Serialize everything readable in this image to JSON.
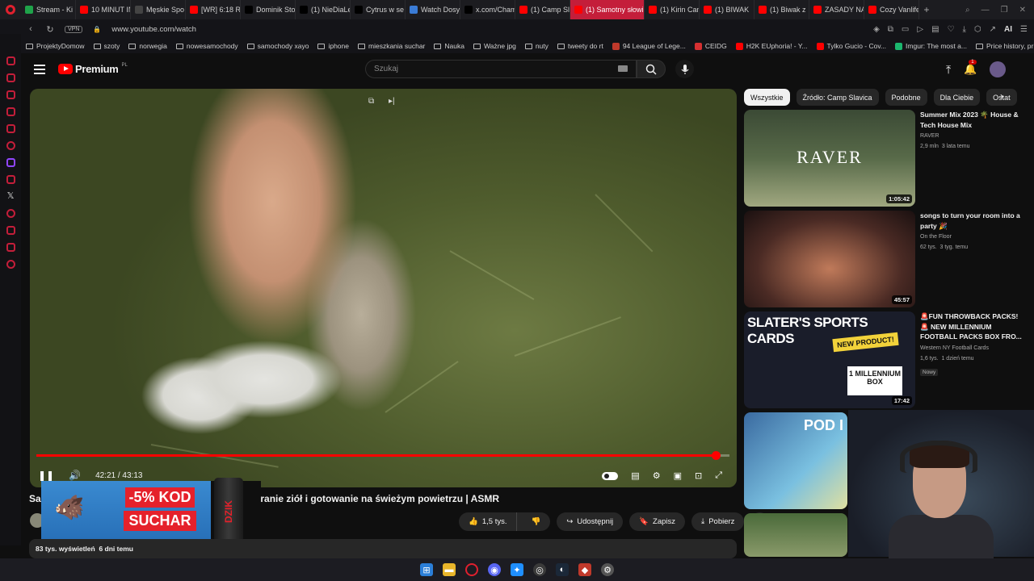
{
  "browser": {
    "tabs": [
      {
        "label": "Stream - Ki",
        "color": "#1fa34a"
      },
      {
        "label": "10 MINUT IN",
        "color": "#ff0000"
      },
      {
        "label": "Męskie Spo",
        "color": "#444444"
      },
      {
        "label": "[WR] 6:18 R",
        "color": "#ff0000"
      },
      {
        "label": "Dominik Sto",
        "color": "#000000"
      },
      {
        "label": "(1) NieDiaLe",
        "color": "#000000"
      },
      {
        "label": "Cytrus w se",
        "color": "#000000"
      },
      {
        "label": "Watch Dosy",
        "color": "#3a7bd5"
      },
      {
        "label": "x.com/Cham",
        "color": "#000000"
      },
      {
        "label": "(1) Camp Sla",
        "color": "#ff0000"
      },
      {
        "label": "(1) Samotny słowi",
        "color": "#ff0000",
        "active": true
      },
      {
        "label": "(1) Kirin Cam",
        "color": "#ff0000"
      },
      {
        "label": "(1) BIWAK",
        "color": "#ff0000"
      },
      {
        "label": "(1) Biwak z",
        "color": "#ff0000"
      },
      {
        "label": "ZASADY NA",
        "color": "#ff0000"
      },
      {
        "label": "Cozy Vanlife",
        "color": "#ff0000"
      }
    ],
    "url": "www.youtube.com/watch",
    "vpn_label": "VPN",
    "ai_label": "AI",
    "bookmarks": [
      {
        "label": "ProjektyDomow",
        "type": "folder"
      },
      {
        "label": "szoty",
        "type": "folder"
      },
      {
        "label": "norwegia",
        "type": "folder"
      },
      {
        "label": "nowesamochody",
        "type": "folder"
      },
      {
        "label": "samochody xayo",
        "type": "folder"
      },
      {
        "label": "iphone",
        "type": "folder"
      },
      {
        "label": "mieszkania suchar",
        "type": "folder"
      },
      {
        "label": "Nauka",
        "type": "folder"
      },
      {
        "label": "Ważne jpg",
        "type": "folder"
      },
      {
        "label": "nuty",
        "type": "folder"
      },
      {
        "label": "tweety do rt",
        "type": "folder"
      },
      {
        "label": "94 League of Lege...",
        "type": "site",
        "color": "#c0392b"
      },
      {
        "label": "CEIDG",
        "type": "site",
        "color": "#d63031"
      },
      {
        "label": "H2K EUphoria! - Y...",
        "type": "site",
        "color": "#ff0000"
      },
      {
        "label": "Tylko Gucio - Cov...",
        "type": "site",
        "color": "#ff0000"
      },
      {
        "label": "Imgur: The most a...",
        "type": "site",
        "color": "#1bb76e"
      },
      {
        "label": "Price history, price...",
        "type": "folder"
      }
    ]
  },
  "youtube": {
    "logo_text": "Premium",
    "logo_region": "PL",
    "search_placeholder": "Szukaj",
    "notification_count": "1",
    "player": {
      "time": "42:21 / 43:13",
      "progress": 0.98
    },
    "video_title_visible": "Sa",
    "video_title_rest": "eranie ziół i gotowanie na świeżym powietrzu | ASMR",
    "promo": {
      "discount": "-5% KOD",
      "code": "SUCHAR",
      "brand": "DZIK"
    },
    "actions": {
      "likes": "1,5 tys.",
      "share": "Udostępnij",
      "save": "Zapisz",
      "download": "Pobierz"
    },
    "description": {
      "views": "83 tys. wyświetleń",
      "age": "6 dni temu"
    },
    "chips": [
      "Wszystkie",
      "Źródło: Camp Slavica",
      "Podobne",
      "Dla Ciebie",
      "Ostat"
    ],
    "recommendations": [
      {
        "title": "Summer Mix 2023 🌴 House & Tech House Mix",
        "channel": "RAVER",
        "views": "2,9 mln",
        "age": "3 lata temu",
        "duration": "1:05:42",
        "thumb_text": "RAVER"
      },
      {
        "title": "songs to turn your room into a party 🎉",
        "channel": "On the Floor",
        "views": "62 tys.",
        "age": "3 tyg. temu",
        "duration": "45:57"
      },
      {
        "title": "🚨FUN THROWBACK PACKS! 🚨 NEW MILLENNIUM FOOTBALL PACKS BOX FRO...",
        "channel": "Western NY Football Cards",
        "views": "1,6 tys.",
        "age": "1 dzień temu",
        "duration": "17:42",
        "badge": "Nowy",
        "thumb_text": "SLATER'S SPORTS CARDS",
        "thumb_sub": "NEW PRODUCT!",
        "thumb_box": "1 MILLENNIUM BOX"
      },
      {
        "title": "",
        "thumb_text": "POD I"
      }
    ]
  }
}
